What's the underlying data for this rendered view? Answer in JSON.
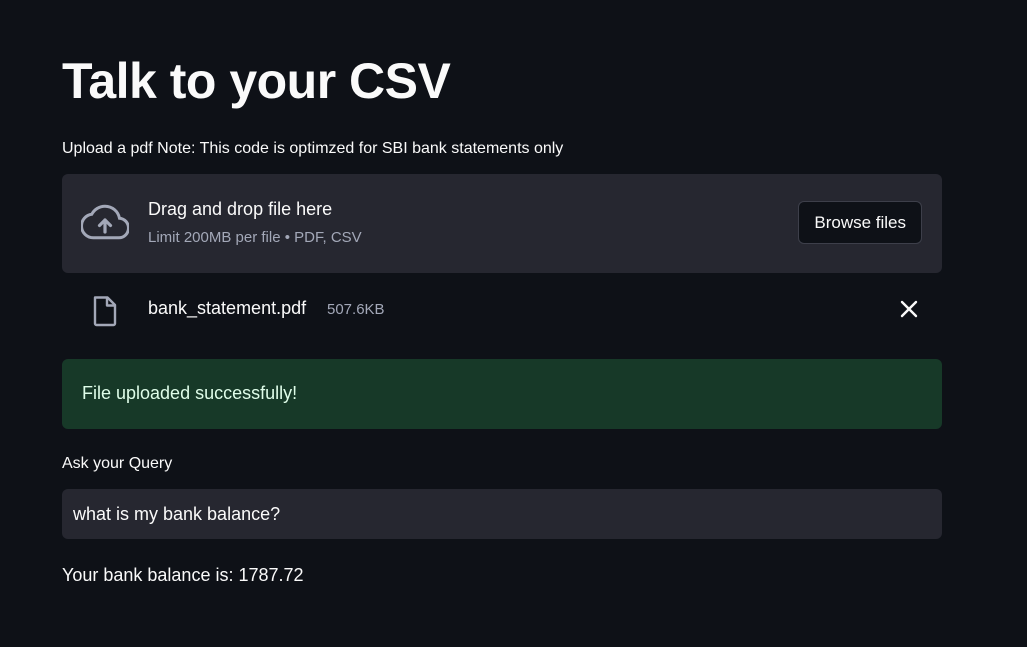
{
  "app": {
    "title": "Talk to your CSV"
  },
  "uploader": {
    "label": "Upload a pdf Note: This code is optimzed for SBI bank statements only",
    "dropzone_title": "Drag and drop file here",
    "dropzone_subtitle": "Limit 200MB per file • PDF, CSV",
    "browse_label": "Browse files",
    "icon": "cloud-upload-icon"
  },
  "uploaded_file": {
    "name": "bank_statement.pdf",
    "size": "507.6KB",
    "icon": "file-icon",
    "remove_icon": "close-icon"
  },
  "alert": {
    "message": "File uploaded successfully!",
    "color": "#173928"
  },
  "query": {
    "label": "Ask your Query",
    "value": "what is my bank balance?"
  },
  "response": {
    "text": "Your bank balance is: 1787.72"
  },
  "colors": {
    "background": "#0e1117",
    "surface": "#262730",
    "text": "#fafafa",
    "muted": "#a3a8b8",
    "success_text": "#dffde9"
  }
}
